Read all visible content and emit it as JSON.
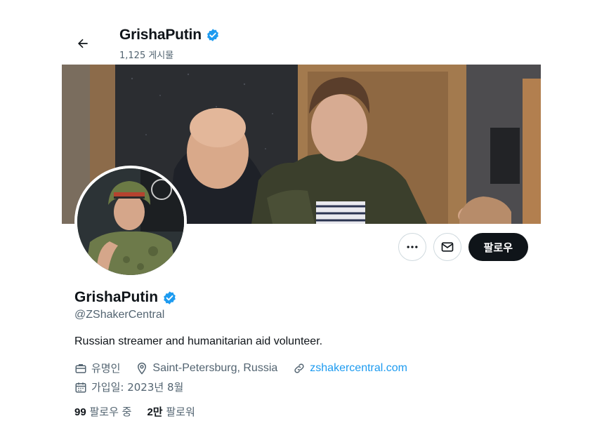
{
  "header": {
    "display_name": "GrishaPutin",
    "posts_count": "1,125 게시물"
  },
  "profile": {
    "display_name": "GrishaPutin",
    "handle": "@ZShakerCentral",
    "bio": "Russian streamer and humanitarian aid volunteer.",
    "category": "유명인",
    "location": "Saint-Petersburg, Russia",
    "website": "zshakercentral.com",
    "joined": "가입일: 2023년 8월",
    "following_count": "99",
    "following_label": "팔로우 중",
    "followers_count": "2만",
    "followers_label": "팔로워"
  },
  "actions": {
    "more_icon": "more-icon",
    "message_icon": "mail-icon",
    "follow_label": "팔로우"
  },
  "colors": {
    "accent": "#1d9bf0",
    "text_primary": "#0f1419",
    "text_secondary": "#536471",
    "button_dark": "#0f1419"
  }
}
